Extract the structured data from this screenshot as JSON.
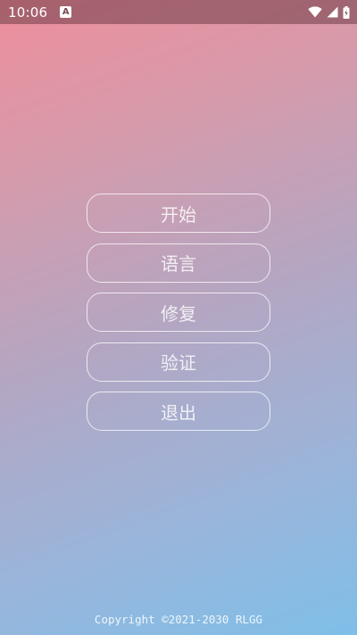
{
  "status_bar": {
    "time": "10:06",
    "notification_letter": "A",
    "icons": [
      "wifi-icon",
      "signal-icon",
      "battery-icon"
    ]
  },
  "menu": {
    "items": [
      {
        "label": "开始"
      },
      {
        "label": "语言"
      },
      {
        "label": "修复"
      },
      {
        "label": "验证"
      },
      {
        "label": "退出"
      }
    ]
  },
  "footer": {
    "copyright": "Copyright ©2021-2030 RLGG"
  },
  "colors": {
    "gradient_top": "#ee8e9c",
    "gradient_bottom": "#7fbfe8",
    "status_bar_bg": "#6e3c46",
    "text": "#ffffff"
  }
}
